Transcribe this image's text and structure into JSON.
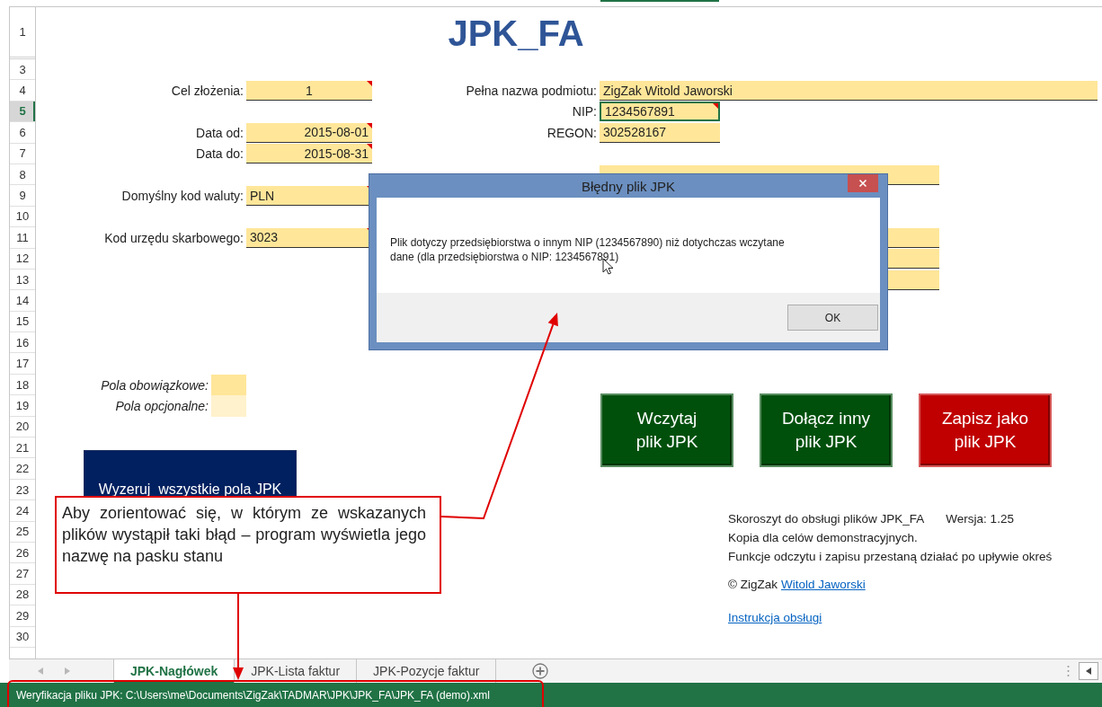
{
  "sheet": {
    "title": "JPK_FA",
    "row_numbers": [
      {
        "label": "1",
        "selected": false
      },
      {
        "label": "3",
        "selected": false
      },
      {
        "label": "4",
        "selected": false
      },
      {
        "label": "5",
        "selected": true
      },
      {
        "label": "6",
        "selected": false
      },
      {
        "label": "7",
        "selected": false
      },
      {
        "label": "8",
        "selected": false
      },
      {
        "label": "9",
        "selected": false
      },
      {
        "label": "10",
        "selected": false
      },
      {
        "label": "11",
        "selected": false
      },
      {
        "label": "12",
        "selected": false
      },
      {
        "label": "13",
        "selected": false
      },
      {
        "label": "14",
        "selected": false
      },
      {
        "label": "15",
        "selected": false
      },
      {
        "label": "16",
        "selected": false
      },
      {
        "label": "17",
        "selected": false
      },
      {
        "label": "18",
        "selected": false
      },
      {
        "label": "19",
        "selected": false
      },
      {
        "label": "20",
        "selected": false
      },
      {
        "label": "21",
        "selected": false
      },
      {
        "label": "22",
        "selected": false
      },
      {
        "label": "23",
        "selected": false
      },
      {
        "label": "24",
        "selected": false
      },
      {
        "label": "25",
        "selected": false
      },
      {
        "label": "26",
        "selected": false
      },
      {
        "label": "27",
        "selected": false
      },
      {
        "label": "28",
        "selected": false
      },
      {
        "label": "29",
        "selected": false
      },
      {
        "label": "30",
        "selected": false
      }
    ],
    "left_fields": [
      {
        "label": "Cel złożenia:",
        "value": "1",
        "comment": true
      },
      {
        "label": "Data od:",
        "value": "2015-08-01",
        "comment": true
      },
      {
        "label": "Data do:",
        "value": "2015-08-31",
        "comment": true
      },
      {
        "label": "Domyślny kod waluty:",
        "value": "PLN",
        "comment": true
      },
      {
        "label": "Kod urzędu skarbowego:",
        "value": "3023",
        "comment": true
      }
    ],
    "right_fields": [
      {
        "label": "Pełna nazwa podmiotu:",
        "value": "ZigZak Witold Jaworski",
        "comment": false,
        "selected": false
      },
      {
        "label": "NIP:",
        "value": "1234567891",
        "comment": true,
        "selected": true
      },
      {
        "label": "REGON:",
        "value": "302528167",
        "comment": false,
        "selected": false
      }
    ],
    "legend": [
      {
        "label": "Pola obowiązkowe:",
        "color": "#ffe699"
      },
      {
        "label": "Pola opcjonalne:",
        "color": "#fff2cc"
      }
    ],
    "reset_button": "Wyzeruj  wszystkie pola JPK",
    "action_buttons": [
      {
        "lines": [
          "Wczytaj",
          "plik JPK"
        ],
        "color": "#00500c"
      },
      {
        "lines": [
          "Dołącz inny",
          "plik JPK"
        ],
        "color": "#00500c"
      },
      {
        "lines": [
          "Zapisz jako",
          "plik JPK"
        ],
        "color": "#c00000"
      }
    ],
    "info": {
      "product": "Skoroszyt do obsługi plików JPK_FA",
      "version": "Wersja: 1.25",
      "copy_note": "Kopia dla celów demonstracyjnych.",
      "expiry_note": "Funkcje odczytu i zapisu przestaną działać po upływie okreś",
      "copyright": "© ZigZak",
      "author_link": "Witold Jaworski",
      "manual_link": "Instrukcja obsługi"
    }
  },
  "dialog": {
    "title": "Błędny plik JPK",
    "message": "Plik dotyczy przedsiębiorstwa o innym NIP (1234567890) niż dotychczas wczytane dane (dla przedsiębiorstwa o NIP: 1234567891)",
    "ok_button": "OK"
  },
  "callout": {
    "text": "Aby zorientować się, w którym ze wskazanych plików wystąpił taki błąd – program wyświetla jego nazwę na pasku stanu"
  },
  "sheet_tabs": [
    {
      "label": "JPK-Nagłówek",
      "selected": true
    },
    {
      "label": "JPK-Lista faktur",
      "selected": false
    },
    {
      "label": "JPK-Pozycje faktur",
      "selected": false
    }
  ],
  "status_bar": {
    "text": "Weryfikacja pliku JPK: C:\\Users\\me\\Documents\\ZigZak\\TADMAR\\JPK\\JPK_FA\\JPK_FA (demo).xml"
  }
}
